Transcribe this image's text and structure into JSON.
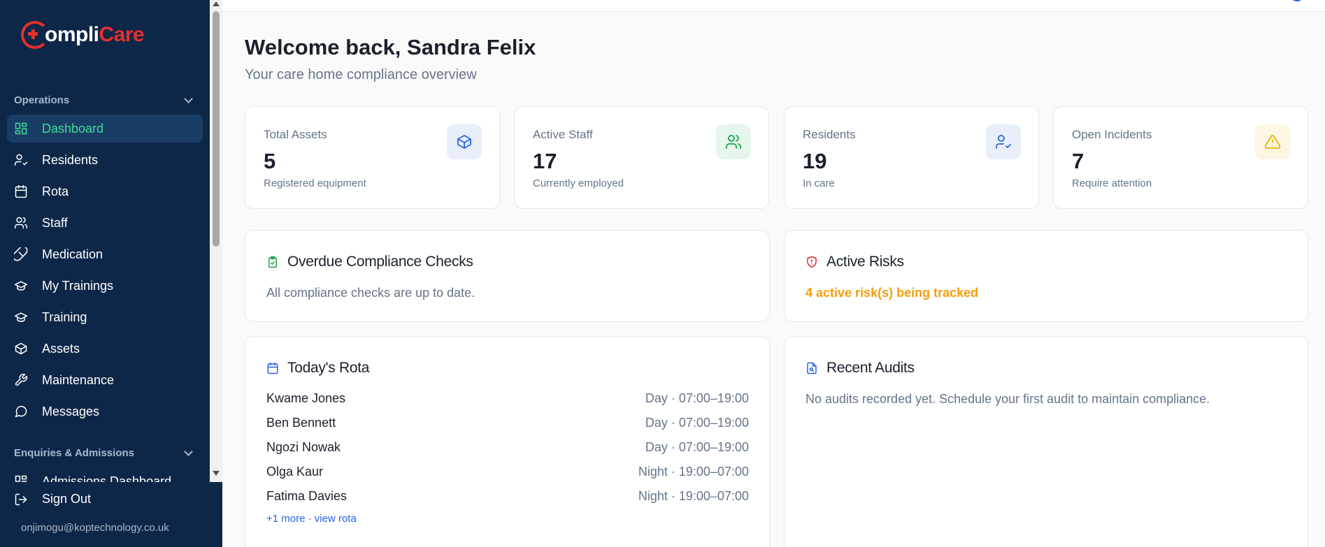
{
  "brand": {
    "name_part1": "ompli",
    "name_part2": "Care"
  },
  "sidebar": {
    "sections": [
      {
        "label": "Operations"
      },
      {
        "label": "Enquiries & Admissions"
      }
    ],
    "items": [
      {
        "label": "Dashboard"
      },
      {
        "label": "Residents"
      },
      {
        "label": "Rota"
      },
      {
        "label": "Staff"
      },
      {
        "label": "Medication"
      },
      {
        "label": "My Trainings"
      },
      {
        "label": "Training"
      },
      {
        "label": "Assets"
      },
      {
        "label": "Maintenance"
      },
      {
        "label": "Messages"
      },
      {
        "label": "Admissions Dashboard"
      }
    ],
    "sign_out": "Sign Out",
    "user_email": "onjimogu@koptechnology.co.uk"
  },
  "header": {
    "welcome": "Welcome back, Sandra Felix",
    "subtitle": "Your care home compliance overview"
  },
  "stats": [
    {
      "label": "Total Assets",
      "value": "5",
      "sub": "Registered equipment",
      "icon": "box-icon",
      "color": "#2563eb",
      "bg": "#e8eefa"
    },
    {
      "label": "Active Staff",
      "value": "17",
      "sub": "Currently employed",
      "icon": "users-icon",
      "color": "#16a34a",
      "bg": "#e6f6ec"
    },
    {
      "label": "Residents",
      "value": "19",
      "sub": "In care",
      "icon": "user-check-icon",
      "color": "#2563eb",
      "bg": "#e8eefa"
    },
    {
      "label": "Open Incidents",
      "value": "7",
      "sub": "Require attention",
      "icon": "alert-triangle-icon",
      "color": "#eab308",
      "bg": "#fdf6e3"
    }
  ],
  "compliance": {
    "title": "Overdue Compliance Checks",
    "text": "All compliance checks are up to date."
  },
  "risks": {
    "title": "Active Risks",
    "text": "4 active risk(s) being tracked"
  },
  "rota": {
    "title": "Today's Rota",
    "rows": [
      {
        "name": "Kwame Jones",
        "shift": "Day · 07:00–19:00"
      },
      {
        "name": "Ben Bennett",
        "shift": "Day · 07:00–19:00"
      },
      {
        "name": "Ngozi Nowak",
        "shift": "Day · 07:00–19:00"
      },
      {
        "name": "Olga Kaur",
        "shift": "Night · 19:00–07:00"
      },
      {
        "name": "Fatima Davies",
        "shift": "Night · 19:00–07:00"
      }
    ],
    "more": "+1 more · view rota"
  },
  "audits": {
    "title": "Recent Audits",
    "text": "No audits recorded yet. Schedule your first audit to maintain compliance."
  },
  "colors": {
    "sidebar_bg": "#0d2748",
    "active_green": "#3ddc97",
    "brand_red": "#e53030",
    "risk_orange": "#f59e0b",
    "link_blue": "#2563eb"
  }
}
